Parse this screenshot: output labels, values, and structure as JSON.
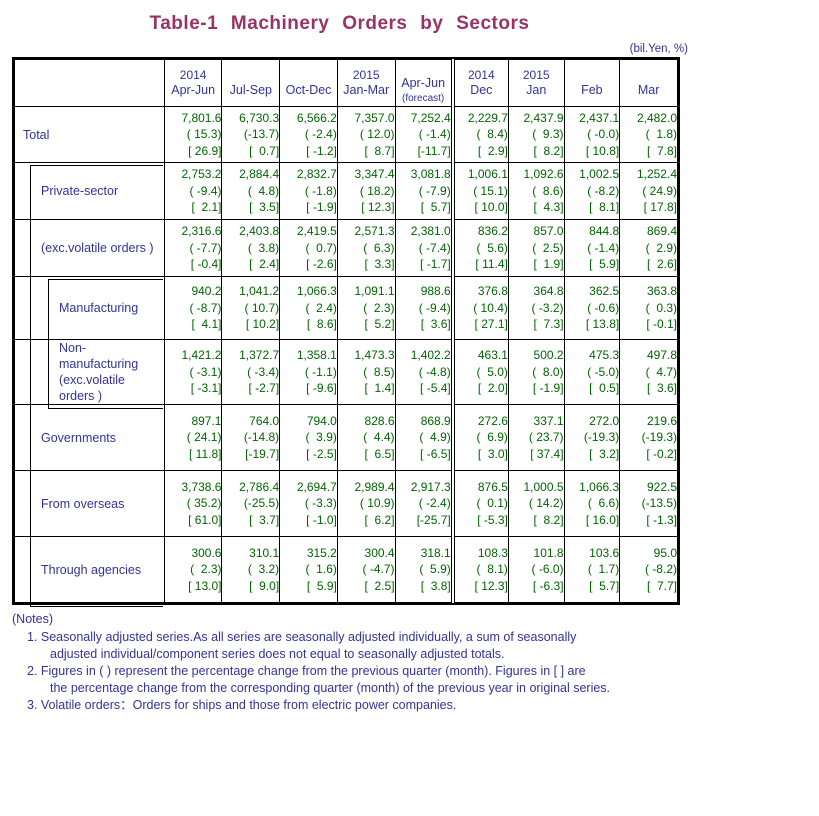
{
  "title": "Table-1  Machinery  Orders  by  Sectors",
  "unit_caption": "(bil.Yen, %)",
  "header": {
    "corner_label": "",
    "columns": [
      {
        "year": "2014",
        "period": "Apr-Jun",
        "note": ""
      },
      {
        "year": "",
        "period": "Jul-Sep",
        "note": ""
      },
      {
        "year": "",
        "period": "Oct-Dec",
        "note": ""
      },
      {
        "year": "2015",
        "period": "Jan-Mar",
        "note": ""
      },
      {
        "year": "",
        "period": "Apr-Jun",
        "note": "(forecast)"
      },
      {
        "year": "2014",
        "period": "Dec",
        "note": ""
      },
      {
        "year": "2015",
        "period": "Jan",
        "note": ""
      },
      {
        "year": "",
        "period": "Feb",
        "note": ""
      },
      {
        "year": "",
        "period": "Mar",
        "note": ""
      }
    ]
  },
  "rows": [
    {
      "label": "Total",
      "label2": "",
      "level": 1,
      "cells": [
        {
          "value": "7,801.6",
          "qoq": "( 15.3)",
          "yoy": "[ 26.9]"
        },
        {
          "value": "6,730.3",
          "qoq": "(-13.7)",
          "yoy": "[  0.7]"
        },
        {
          "value": "6,566.2",
          "qoq": "( -2.4)",
          "yoy": "[ -1.2]"
        },
        {
          "value": "7,357.0",
          "qoq": "( 12.0)",
          "yoy": "[  8.7]"
        },
        {
          "value": "7,252.4",
          "qoq": "( -1.4)",
          "yoy": "[-11.7]"
        },
        {
          "value": "2,229.7",
          "qoq": "(  8.4)",
          "yoy": "[  2.9]"
        },
        {
          "value": "2,437.9",
          "qoq": "(  9.3)",
          "yoy": "[  8.2]"
        },
        {
          "value": "2,437.1",
          "qoq": "( -0.0)",
          "yoy": "[ 10.8]"
        },
        {
          "value": "2,482.0",
          "qoq": "(  1.8)",
          "yoy": "[  7.8]"
        }
      ]
    },
    {
      "label": "Private-sector",
      "label2": "",
      "level": 2,
      "cells": [
        {
          "value": "2,753.2",
          "qoq": "( -9.4)",
          "yoy": "[  2.1]"
        },
        {
          "value": "2,884.4",
          "qoq": "(  4.8)",
          "yoy": "[  3.5]"
        },
        {
          "value": "2,832.7",
          "qoq": "( -1.8)",
          "yoy": "[ -1.9]"
        },
        {
          "value": "3,347.4",
          "qoq": "( 18.2)",
          "yoy": "[ 12.3]"
        },
        {
          "value": "3,081.8",
          "qoq": "( -7.9)",
          "yoy": "[  5.7]"
        },
        {
          "value": "1,006.1",
          "qoq": "( 15.1)",
          "yoy": "[ 10.0]"
        },
        {
          "value": "1,092.6",
          "qoq": "(  8.6)",
          "yoy": "[  4.3]"
        },
        {
          "value": "1,002.5",
          "qoq": "( -8.2)",
          "yoy": "[  8.1]"
        },
        {
          "value": "1,252.4",
          "qoq": "( 24.9)",
          "yoy": "[ 17.8]"
        }
      ]
    },
    {
      "label": "(exc.volatile orders )",
      "label2": "",
      "level": 2,
      "cells": [
        {
          "value": "2,316.6",
          "qoq": "( -7.7)",
          "yoy": "[ -0.4]"
        },
        {
          "value": "2,403.8",
          "qoq": "(  3.8)",
          "yoy": "[  2.4]"
        },
        {
          "value": "2,419.5",
          "qoq": "(  0.7)",
          "yoy": "[ -2.6]"
        },
        {
          "value": "2,571.3",
          "qoq": "(  6.3)",
          "yoy": "[  3.3]"
        },
        {
          "value": "2,381.0",
          "qoq": "( -7.4)",
          "yoy": "[ -1.7]"
        },
        {
          "value": "836.2",
          "qoq": "(  5.6)",
          "yoy": "[ 11.4]"
        },
        {
          "value": "857.0",
          "qoq": "(  2.5)",
          "yoy": "[  1.9]"
        },
        {
          "value": "844.8",
          "qoq": "( -1.4)",
          "yoy": "[  5.9]"
        },
        {
          "value": "869.4",
          "qoq": "(  2.9)",
          "yoy": "[  2.6]"
        }
      ]
    },
    {
      "label": "Manufacturing",
      "label2": "",
      "level": 3,
      "cells": [
        {
          "value": "940.2",
          "qoq": "( -8.7)",
          "yoy": "[  4.1]"
        },
        {
          "value": "1,041.2",
          "qoq": "( 10.7)",
          "yoy": "[ 10.2]"
        },
        {
          "value": "1,066.3",
          "qoq": "(  2.4)",
          "yoy": "[  8.6]"
        },
        {
          "value": "1,091.1",
          "qoq": "(  2.3)",
          "yoy": "[  5.2]"
        },
        {
          "value": "988.6",
          "qoq": "( -9.4)",
          "yoy": "[  3.6]"
        },
        {
          "value": "376.8",
          "qoq": "( 10.4)",
          "yoy": "[ 27.1]"
        },
        {
          "value": "364.8",
          "qoq": "( -3.2)",
          "yoy": "[  7.3]"
        },
        {
          "value": "362.5",
          "qoq": "( -0.6)",
          "yoy": "[ 13.8]"
        },
        {
          "value": "363.8",
          "qoq": "(  0.3)",
          "yoy": "[ -0.1]"
        }
      ]
    },
    {
      "label": "Non-manufacturing",
      "label2": "(exc.volatile orders )",
      "level": 3,
      "cells": [
        {
          "value": "1,421.2",
          "qoq": "( -3.1)",
          "yoy": "[ -3.1]"
        },
        {
          "value": "1,372.7",
          "qoq": "( -3.4)",
          "yoy": "[ -2.7]"
        },
        {
          "value": "1,358.1",
          "qoq": "( -1.1)",
          "yoy": "[ -9.6]"
        },
        {
          "value": "1,473.3",
          "qoq": "(  8.5)",
          "yoy": "[  1.4]"
        },
        {
          "value": "1,402.2",
          "qoq": "( -4.8)",
          "yoy": "[ -5.4]"
        },
        {
          "value": "463.1",
          "qoq": "(  5.0)",
          "yoy": "[  2.0]"
        },
        {
          "value": "500.2",
          "qoq": "(  8.0)",
          "yoy": "[ -1.9]"
        },
        {
          "value": "475.3",
          "qoq": "( -5.0)",
          "yoy": "[  0.5]"
        },
        {
          "value": "497.8",
          "qoq": "(  4.7)",
          "yoy": "[  3.6]"
        }
      ]
    },
    {
      "label": "Governments",
      "label2": "",
      "level": 2,
      "cells": [
        {
          "value": "897.1",
          "qoq": "( 24.1)",
          "yoy": "[ 11.8]"
        },
        {
          "value": "764.0",
          "qoq": "(-14.8)",
          "yoy": "[-19.7]"
        },
        {
          "value": "794.0",
          "qoq": "(  3.9)",
          "yoy": "[ -2.5]"
        },
        {
          "value": "828.6",
          "qoq": "(  4.4)",
          "yoy": "[  6.5]"
        },
        {
          "value": "868.9",
          "qoq": "(  4.9)",
          "yoy": "[ -6.5]"
        },
        {
          "value": "272.6",
          "qoq": "(  6.9)",
          "yoy": "[  3.0]"
        },
        {
          "value": "337.1",
          "qoq": "( 23.7)",
          "yoy": "[ 37.4]"
        },
        {
          "value": "272.0",
          "qoq": "(-19.3)",
          "yoy": "[  3.2]"
        },
        {
          "value": "219.6",
          "qoq": "(-19.3)",
          "yoy": "[ -0.2]"
        }
      ]
    },
    {
      "label": "From overseas",
      "label2": "",
      "level": 2,
      "cells": [
        {
          "value": "3,738.6",
          "qoq": "( 35.2)",
          "yoy": "[ 61.0]"
        },
        {
          "value": "2,786.4",
          "qoq": "(-25.5)",
          "yoy": "[  3.7]"
        },
        {
          "value": "2,694.7",
          "qoq": "( -3.3)",
          "yoy": "[ -1.0]"
        },
        {
          "value": "2,989.4",
          "qoq": "( 10.9)",
          "yoy": "[  6.2]"
        },
        {
          "value": "2,917.3",
          "qoq": "( -2.4)",
          "yoy": "[-25.7]"
        },
        {
          "value": "876.5",
          "qoq": "(  0.1)",
          "yoy": "[ -5.3]"
        },
        {
          "value": "1,000.5",
          "qoq": "( 14.2)",
          "yoy": "[  8.2]"
        },
        {
          "value": "1,066.3",
          "qoq": "(  6.6)",
          "yoy": "[ 16.0]"
        },
        {
          "value": "922.5",
          "qoq": "(-13.5)",
          "yoy": "[ -1.3]"
        }
      ]
    },
    {
      "label": "Through agencies",
      "label2": "",
      "level": 2,
      "cells": [
        {
          "value": "300.6",
          "qoq": "(  2.3)",
          "yoy": "[ 13.0]"
        },
        {
          "value": "310.1",
          "qoq": "(  3.2)",
          "yoy": "[  9.0]"
        },
        {
          "value": "315.2",
          "qoq": "(  1.6)",
          "yoy": "[  5.9]"
        },
        {
          "value": "300.4",
          "qoq": "( -4.7)",
          "yoy": "[  2.5]"
        },
        {
          "value": "318.1",
          "qoq": "(  5.9)",
          "yoy": "[  3.8]"
        },
        {
          "value": "108.3",
          "qoq": "(  8.1)",
          "yoy": "[ 12.3]"
        },
        {
          "value": "101.8",
          "qoq": "( -6.0)",
          "yoy": "[ -6.3]"
        },
        {
          "value": "103.6",
          "qoq": "(  1.7)",
          "yoy": "[  5.7]"
        },
        {
          "value": "95.0",
          "qoq": "( -8.2)",
          "yoy": "[  7.7]"
        }
      ]
    }
  ],
  "notes": {
    "heading": "(Notes)",
    "items": [
      {
        "line1": "1. Seasonally adjusted series.As all series are seasonally adjusted individually, a sum of seasonally",
        "line2": "adjusted individual/component series does not equal to seasonally adjusted totals."
      },
      {
        "line1": "2. Figures in ( ) represent the percentage change from the previous quarter (month). Figures in [ ] are",
        "line2": "the percentage change from the corresponding quarter (month) of the previous year in original series."
      },
      {
        "line1": "3. Volatile orders：Orders for ships and those from electric power companies.",
        "line2": ""
      }
    ]
  },
  "colors": {
    "title": "#993366",
    "label_text": "#333399",
    "number_text": "#006600",
    "grid": "#000000",
    "background": "#ffffff"
  }
}
